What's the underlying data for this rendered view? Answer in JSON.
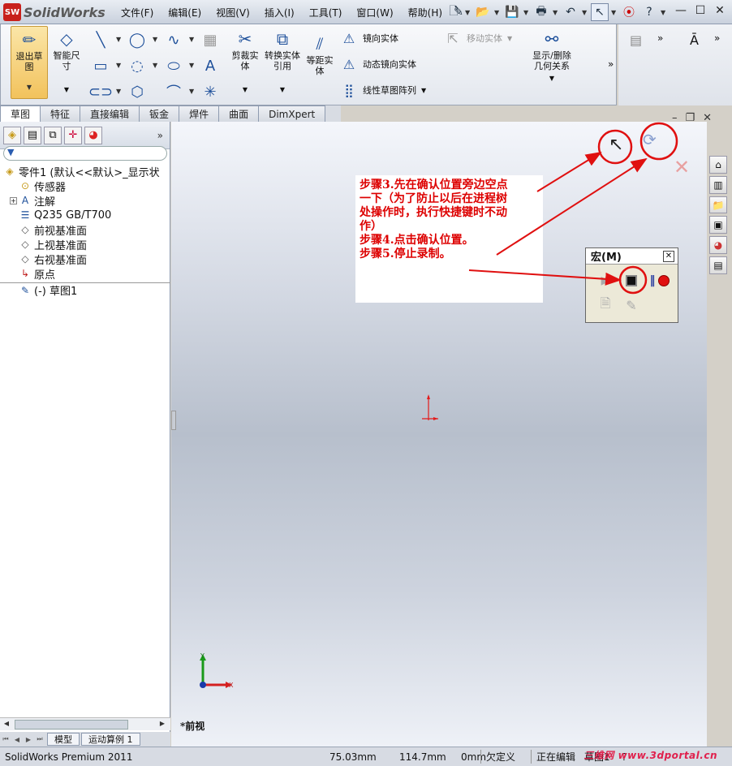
{
  "app": {
    "logo_badge": "SW",
    "logo_name": "SolidWorks"
  },
  "menus": [
    "文件(F)",
    "编辑(E)",
    "视图(V)",
    "插入(I)",
    "工具(T)",
    "窗口(W)",
    "帮助(H)"
  ],
  "command_manager": {
    "exit_sketch": "退出草图",
    "smart_dimension": "智能尺寸",
    "trim_entities": "剪裁实体",
    "convert_entities": "转换实体引用",
    "offset_entities": "等距实体",
    "mirror_entities": "镜向实体",
    "dynamic_mirror": "动态镜向实体",
    "linear_pattern": "线性草图阵列",
    "move_entities": "移动实体",
    "display_relations": "显示/删除几何关系"
  },
  "tabs": [
    "草图",
    "特征",
    "直接编辑",
    "钣金",
    "焊件",
    "曲面",
    "DimXpert"
  ],
  "active_tab": "草图",
  "feature_tree": [
    {
      "label": "零件1 (默认<<默认>_显示状",
      "icon": "part-icon",
      "indent": 0
    },
    {
      "label": "传感器",
      "icon": "sensor-icon",
      "indent": 1
    },
    {
      "label": "注解",
      "icon": "annotation-icon",
      "indent": 1,
      "expandable": true
    },
    {
      "label": "Q235 GB/T700",
      "icon": "material-icon",
      "indent": 1
    },
    {
      "label": "前视基准面",
      "icon": "plane-icon",
      "indent": 1
    },
    {
      "label": "上视基准面",
      "icon": "plane-icon",
      "indent": 1
    },
    {
      "label": "右视基准面",
      "icon": "plane-icon",
      "indent": 1
    },
    {
      "label": "原点",
      "icon": "origin-icon",
      "indent": 1
    },
    {
      "label": "(-) 草图1",
      "icon": "sketch-icon",
      "indent": 1
    }
  ],
  "bottom_tabs": [
    "模型",
    "运动算例 1"
  ],
  "status": {
    "product": "SolidWorks Premium 2011",
    "x": "75.03mm",
    "y": "114.7mm",
    "z": "0mm",
    "state": "欠定义",
    "editing": "正在编辑",
    "sketch": "草图1"
  },
  "watermark": "三维网 www.3dportal.cn",
  "annotation": [
    "步骤3.先在确认位置旁边空点",
    "一下（为了防止以后在进程树",
    "处操作时，执行快捷键时不动",
    "作）",
    "步骤4.点击确认位置。",
    "步骤5.停止录制。"
  ],
  "macro_toolbar": {
    "title": "宏(M)",
    "close": "✕"
  },
  "view_label": "*前视",
  "triad": {
    "x": "X",
    "y": "Y"
  },
  "colors": {
    "annotation_red": "#dd0000",
    "sketch_red": "#e41a1a",
    "tab_border": "#8e9bb0"
  }
}
